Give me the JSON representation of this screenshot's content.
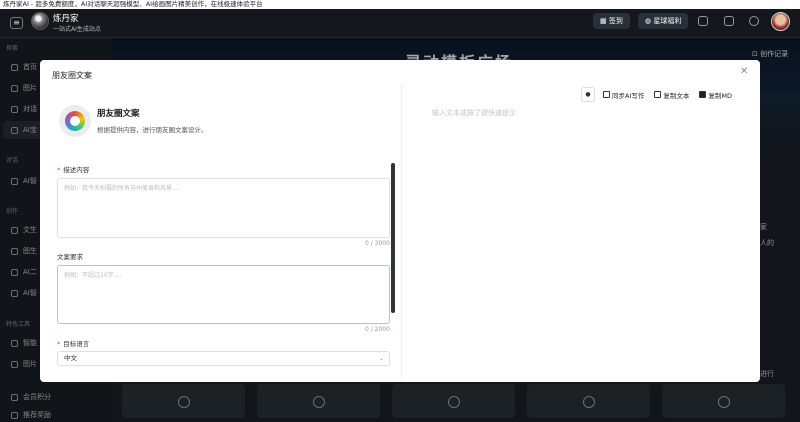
{
  "window": {
    "title": "炼丹家AI - 超多免费额度，AI对话聊天超强模型、AI绘画图片精美创作，在线极速体验平台"
  },
  "header": {
    "brand": "炼丹家",
    "brand_sub": "一站式AI生成站点",
    "signin_label": "签到",
    "welfare_label": "星球福利"
  },
  "sidebar": {
    "explore_heading": "探索",
    "explore_items": [
      "首页",
      "图片",
      "对话",
      "AI宝"
    ],
    "chat_heading": "对话",
    "chat_items": [
      "AI智"
    ],
    "create_heading": "创作",
    "create_items": [
      "文生",
      "图生",
      "AI二",
      "AI智"
    ],
    "tools_heading": "特色工具",
    "tools_items": [
      "智能",
      "图片"
    ],
    "bottom_items": [
      "会员积分",
      "推荐奖励"
    ]
  },
  "background": {
    "hero_title": "灵动模板广场",
    "creation_record": "创作记录",
    "right_fragments": [
      "家",
      "人的",
      "进行"
    ]
  },
  "modal": {
    "title": "朋友圈文案",
    "app_name": "朋友圈文案",
    "app_desc": "根据提供内容，进行朋友圈文案设计。",
    "field1": {
      "label": "描述内容",
      "required": "*",
      "placeholder": "例如：我今天拍摄的所有苏州美食和风景....",
      "counter": "0 / 3000"
    },
    "field2": {
      "label": "文案要求",
      "placeholder": "例如：不超过20字....",
      "counter": "0 / 2000"
    },
    "field3": {
      "label": "目标语言",
      "required": "*",
      "value": "中文"
    },
    "toolbar": {
      "mic_label": "",
      "sync_label": "同步AI写作",
      "copy_text_label": "复制文本",
      "copy_md_label": "复制MD"
    },
    "result_placeholder": "输入文本或按了键快速提示"
  }
}
